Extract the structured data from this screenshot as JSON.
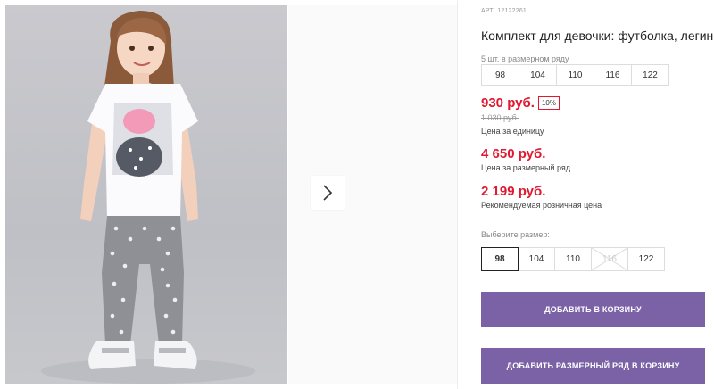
{
  "product": {
    "article_label": "АРТ.",
    "article": "12122261",
    "title": "Комплект для девочки: футболка, легинсы"
  },
  "size_row": {
    "hint": "5 шт. в размерном ряду",
    "sizes": [
      "98",
      "104",
      "110",
      "116",
      "122"
    ]
  },
  "pricing": {
    "price": "930 руб.",
    "discount": "10%",
    "old_price": "1 030 руб.",
    "unit_label": "Цена за единицу",
    "row_price": "4 650 руб.",
    "row_label": "Цена за размерный ряд",
    "rrp_price": "2 199 руб.",
    "rrp_label": "Рекомендуемая розничная цена"
  },
  "size_select": {
    "label": "Выберите размер:",
    "options": [
      "98",
      "104",
      "110",
      "116",
      "122"
    ],
    "selected": "98",
    "unavailable": [
      "116"
    ]
  },
  "actions": {
    "add_to_cart": "ДОБАВИТЬ В КОРЗИНУ",
    "add_row_to_cart": "ДОБАВИТЬ РАЗМЕРНЫЙ РЯД В КОРЗИНУ"
  },
  "colors": {
    "accent": "#7b62a7",
    "price": "#e01830"
  },
  "icons": {
    "next": "chevron-right-icon"
  }
}
